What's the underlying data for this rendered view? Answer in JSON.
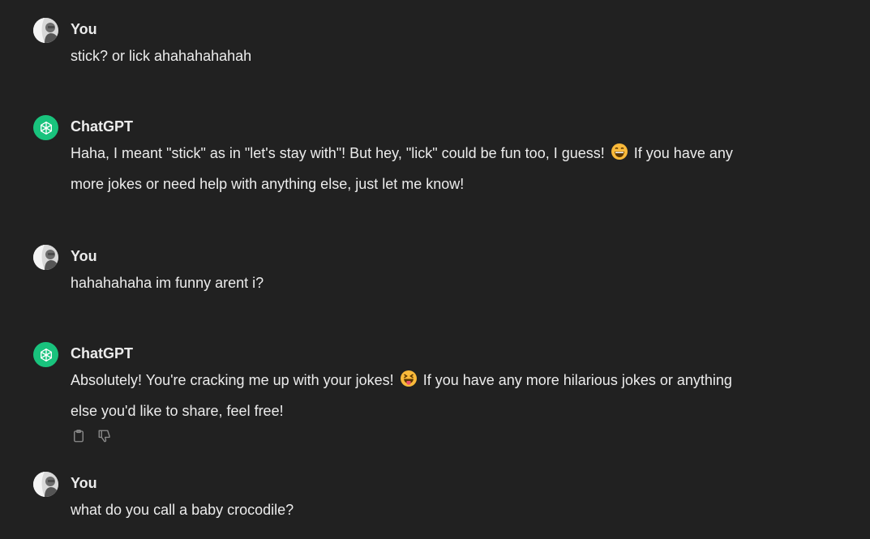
{
  "messages": [
    {
      "author": "You",
      "text": "stick? or lick ahahahahahah"
    },
    {
      "author": "ChatGPT",
      "text_before": "Haha, I meant \"stick\" as in \"let's stay with\"! But hey, \"lick\" could be fun too, I guess!",
      "text_after": "If you have any more jokes or need help with anything else, just let me know!",
      "emoji": "grinning-face-emoji"
    },
    {
      "author": "You",
      "text": "hahahahaha im funny arent i?"
    },
    {
      "author": "ChatGPT",
      "text_before": "Absolutely! You're cracking me up with your jokes!",
      "text_after": "If you have any more hilarious jokes or anything else you'd like to share, feel free!",
      "emoji": "squinting-tongue-face-emoji"
    },
    {
      "author": "You",
      "text": "what do you call a baby crocodile?"
    }
  ],
  "colors": {
    "background": "#212121",
    "text": "#ececec",
    "gpt_avatar": "#19c37d",
    "icon": "#8e8e8e"
  },
  "icons": {
    "copy": "clipboard-icon",
    "dislike": "thumbs-down-icon"
  }
}
